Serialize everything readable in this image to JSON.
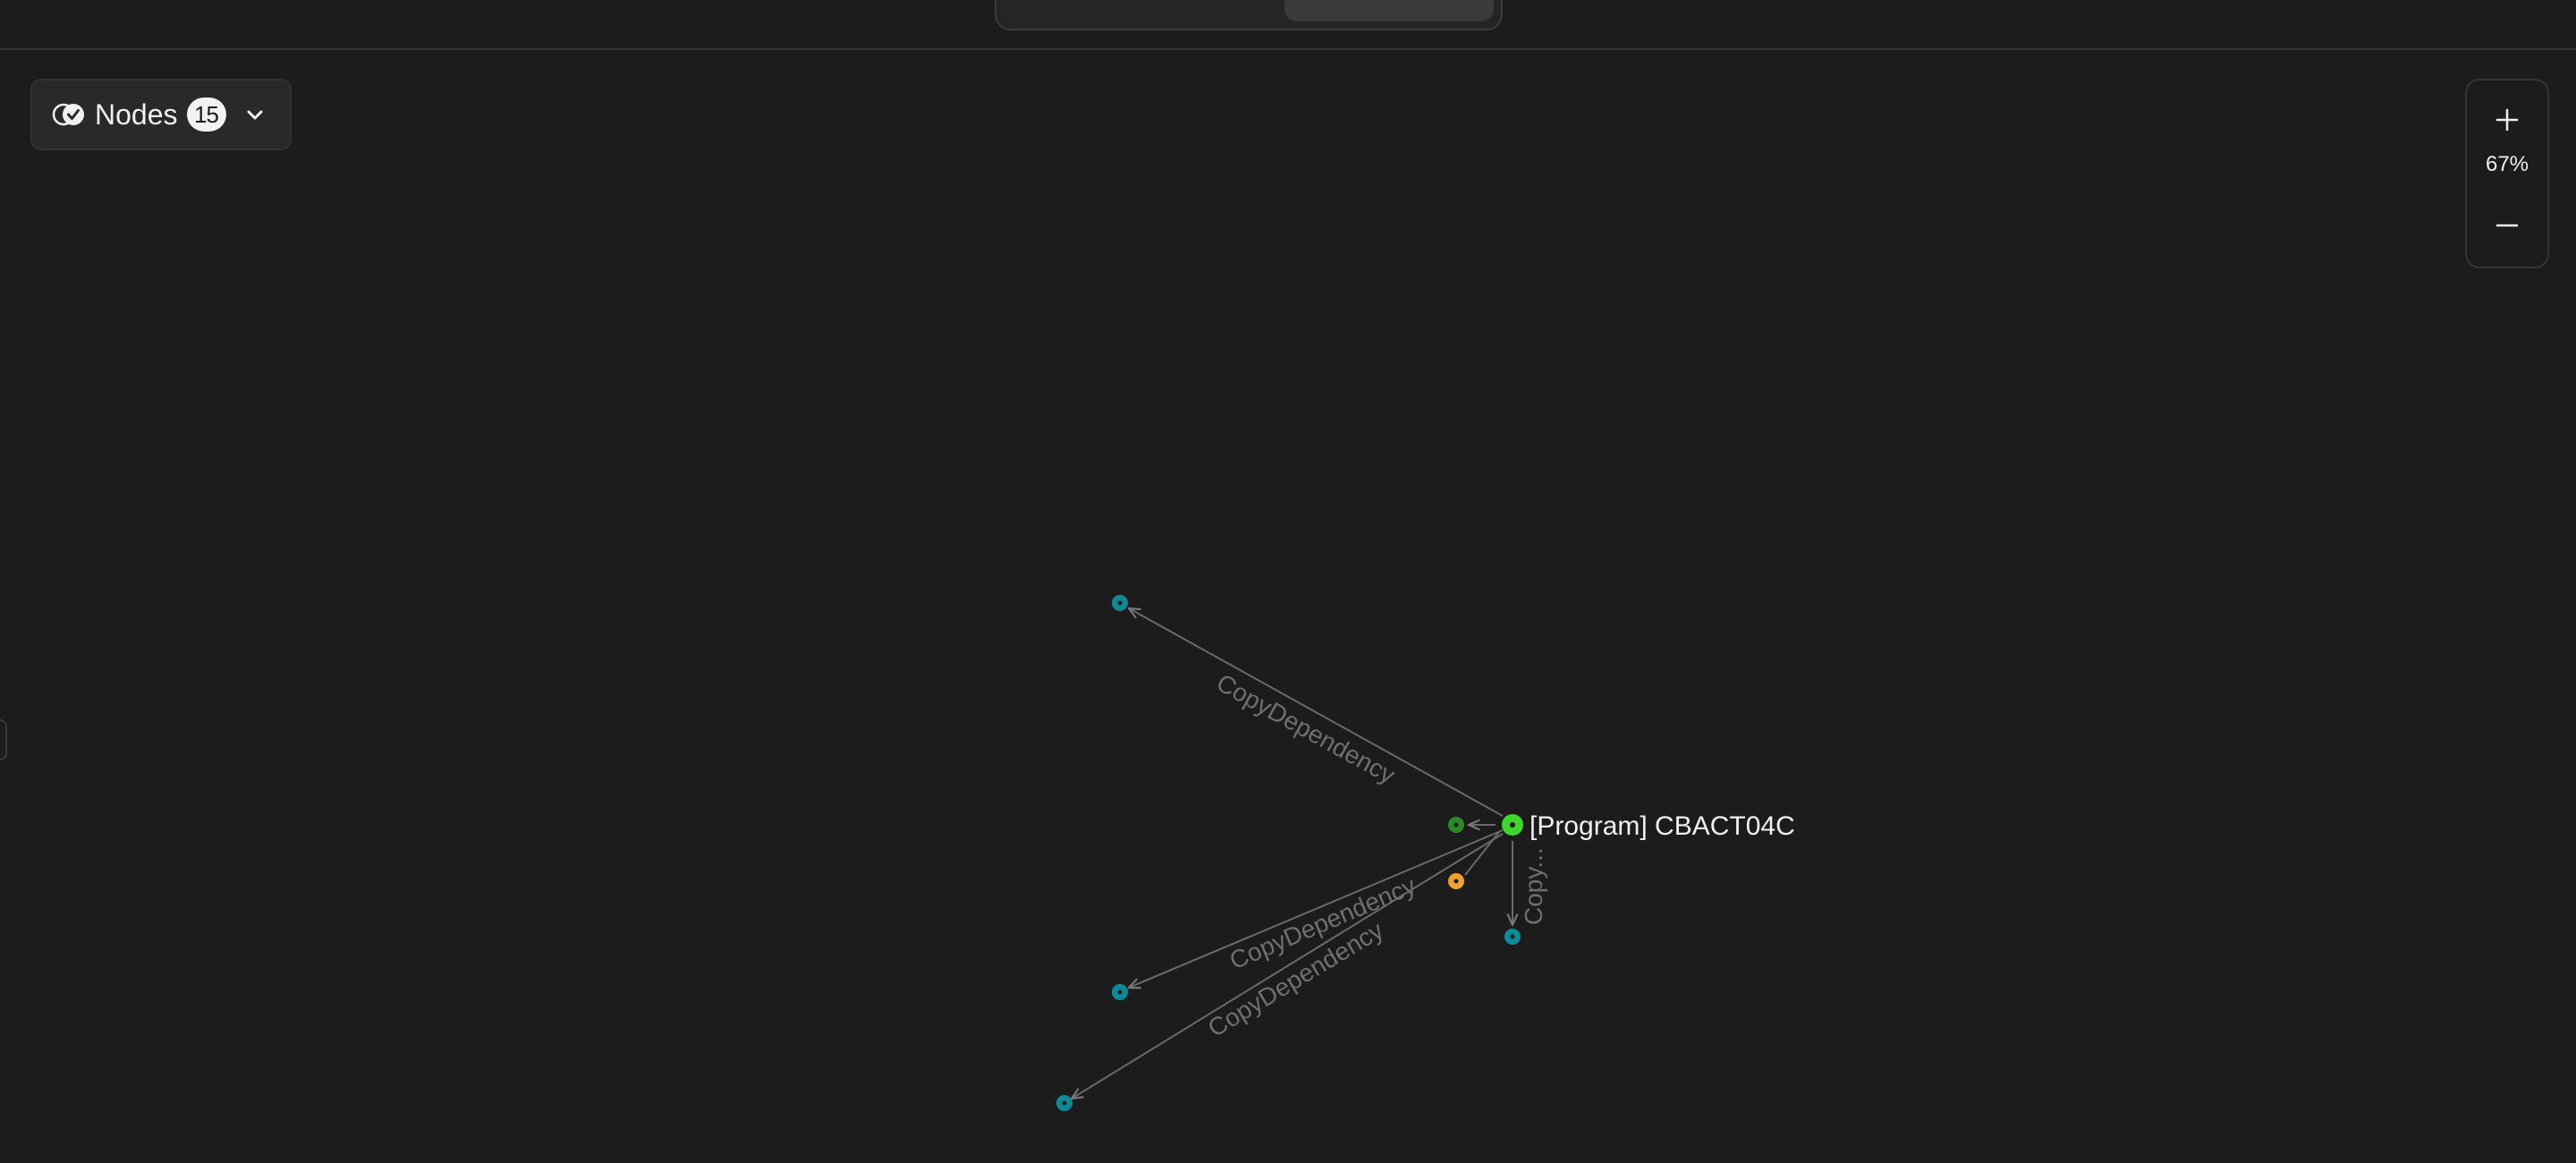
{
  "graph": {
    "edge_label": "CopyDependency",
    "edge_label_short": "Copy...",
    "root_node_label": "[Program] CBACT04C",
    "colors": {
      "root": "#3ed62f",
      "related_green": "#2a8a2a",
      "copy": "#0d8a99",
      "orange": "#f0a030",
      "edge": "#7a7a7a"
    }
  },
  "nodes_panel": {
    "label": "Nodes",
    "count": "15",
    "icon": "toggle-check-icon",
    "chevron": "chevron-down-icon"
  },
  "zoom": {
    "in_icon": "plus-icon",
    "level": "67%",
    "out_icon": "minus-icon"
  }
}
